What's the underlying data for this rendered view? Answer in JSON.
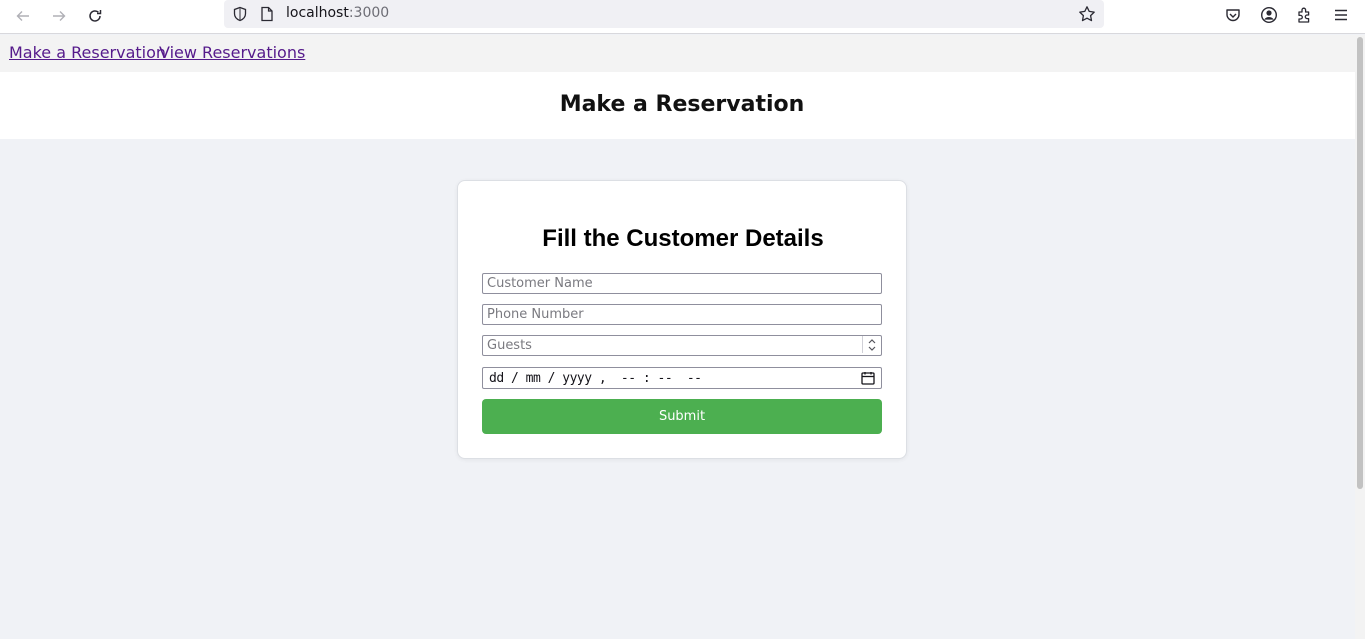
{
  "browser": {
    "url_host": "localhost",
    "url_port": ":3000"
  },
  "nav": {
    "links": [
      {
        "label": "Make a Reservation"
      },
      {
        "label": "View Reservations"
      }
    ]
  },
  "header": {
    "title": "Make a Reservation"
  },
  "form": {
    "title": "Fill the Customer Details",
    "name_placeholder": "Customer Name",
    "phone_placeholder": "Phone Number",
    "guests_placeholder": "Guests",
    "datetime_placeholder": "dd / mm / yyyy ,  -- : --  --",
    "submit_label": "Submit"
  },
  "colors": {
    "accent": "#4caf50",
    "link_visited": "#551a8b",
    "page_background": "#f0f2f6"
  }
}
